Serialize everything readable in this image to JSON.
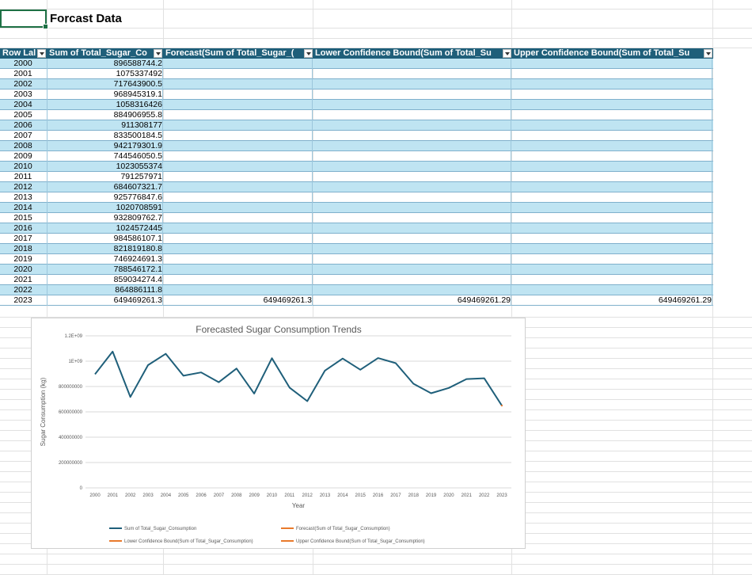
{
  "sheet": {
    "title": "Forcast Data"
  },
  "pivot": {
    "headers": [
      "Row Lal",
      "Sum of Total_Sugar_Co",
      "Forecast(Sum of Total_Sugar_(",
      "Lower Confidence Bound(Sum of Total_Su",
      "Upper Confidence Bound(Sum of Total_Su"
    ],
    "rows": [
      {
        "year": "2000",
        "sum": "896588744.2",
        "fc": "",
        "lo": "",
        "up": ""
      },
      {
        "year": "2001",
        "sum": "1075337492",
        "fc": "",
        "lo": "",
        "up": ""
      },
      {
        "year": "2002",
        "sum": "717643900.5",
        "fc": "",
        "lo": "",
        "up": ""
      },
      {
        "year": "2003",
        "sum": "968945319.1",
        "fc": "",
        "lo": "",
        "up": ""
      },
      {
        "year": "2004",
        "sum": "1058316426",
        "fc": "",
        "lo": "",
        "up": ""
      },
      {
        "year": "2005",
        "sum": "884906955.8",
        "fc": "",
        "lo": "",
        "up": ""
      },
      {
        "year": "2006",
        "sum": "911308177",
        "fc": "",
        "lo": "",
        "up": ""
      },
      {
        "year": "2007",
        "sum": "833500184.5",
        "fc": "",
        "lo": "",
        "up": ""
      },
      {
        "year": "2008",
        "sum": "942179301.9",
        "fc": "",
        "lo": "",
        "up": ""
      },
      {
        "year": "2009",
        "sum": "744546050.5",
        "fc": "",
        "lo": "",
        "up": ""
      },
      {
        "year": "2010",
        "sum": "1023055374",
        "fc": "",
        "lo": "",
        "up": ""
      },
      {
        "year": "2011",
        "sum": "791257971",
        "fc": "",
        "lo": "",
        "up": ""
      },
      {
        "year": "2012",
        "sum": "684607321.7",
        "fc": "",
        "lo": "",
        "up": ""
      },
      {
        "year": "2013",
        "sum": "925776847.6",
        "fc": "",
        "lo": "",
        "up": ""
      },
      {
        "year": "2014",
        "sum": "1020708591",
        "fc": "",
        "lo": "",
        "up": ""
      },
      {
        "year": "2015",
        "sum": "932809762.7",
        "fc": "",
        "lo": "",
        "up": ""
      },
      {
        "year": "2016",
        "sum": "1024572445",
        "fc": "",
        "lo": "",
        "up": ""
      },
      {
        "year": "2017",
        "sum": "984586107.1",
        "fc": "",
        "lo": "",
        "up": ""
      },
      {
        "year": "2018",
        "sum": "821819180.8",
        "fc": "",
        "lo": "",
        "up": ""
      },
      {
        "year": "2019",
        "sum": "746924691.3",
        "fc": "",
        "lo": "",
        "up": ""
      },
      {
        "year": "2020",
        "sum": "788546172.1",
        "fc": "",
        "lo": "",
        "up": ""
      },
      {
        "year": "2021",
        "sum": "859034274.4",
        "fc": "",
        "lo": "",
        "up": ""
      },
      {
        "year": "2022",
        "sum": "864886111.8",
        "fc": "",
        "lo": "",
        "up": ""
      },
      {
        "year": "2023",
        "sum": "649469261.3",
        "fc": "649469261.3",
        "lo": "649469261.29",
        "up": "649469261.29"
      }
    ]
  },
  "chart_data": {
    "type": "line",
    "title": "Forecasted Sugar Consumption Trends",
    "xlabel": "Year",
    "ylabel": "Sugar Consumption (kg)",
    "ylim": [
      0,
      1200000000
    ],
    "y_tick_labels": [
      "0",
      "200000000",
      "400000000",
      "600000000",
      "800000000",
      "1E+09",
      "1.2E+09"
    ],
    "categories": [
      "2000",
      "2001",
      "2002",
      "2003",
      "2004",
      "2005",
      "2006",
      "2007",
      "2008",
      "2009",
      "2010",
      "2011",
      "2012",
      "2013",
      "2014",
      "2015",
      "2016",
      "2017",
      "2018",
      "2019",
      "2020",
      "2021",
      "2022",
      "2023"
    ],
    "series": [
      {
        "name": "Sum of Total_Sugar_Consumption",
        "color": "#1f5f7a",
        "values": [
          896588744.2,
          1075337492,
          717643900.5,
          968945319.1,
          1058316426,
          884906955.8,
          911308177,
          833500184.5,
          942179301.9,
          744546050.5,
          1023055374,
          791257971,
          684607321.7,
          925776847.6,
          1020708591,
          932809762.7,
          1024572445,
          984586107.1,
          821819180.8,
          746924691.3,
          788546172.1,
          859034274.4,
          864886111.8,
          649469261.3
        ]
      },
      {
        "name": "Forecast(Sum of Total_Sugar_Consumption)",
        "color": "#e97a2c",
        "values": [
          null,
          null,
          null,
          null,
          null,
          null,
          null,
          null,
          null,
          null,
          null,
          null,
          null,
          null,
          null,
          null,
          null,
          null,
          null,
          null,
          null,
          null,
          null,
          649469261.3
        ]
      },
      {
        "name": "Lower Confidence Bound(Sum of Total_Sugar_Consumption)",
        "color": "#e97a2c",
        "values": [
          null,
          null,
          null,
          null,
          null,
          null,
          null,
          null,
          null,
          null,
          null,
          null,
          null,
          null,
          null,
          null,
          null,
          null,
          null,
          null,
          null,
          null,
          null,
          649469261.29
        ]
      },
      {
        "name": "Upper Confidence Bound(Sum of Total_Sugar_Consumption)",
        "color": "#e97a2c",
        "values": [
          null,
          null,
          null,
          null,
          null,
          null,
          null,
          null,
          null,
          null,
          null,
          null,
          null,
          null,
          null,
          null,
          null,
          null,
          null,
          null,
          null,
          null,
          null,
          649469261.29
        ]
      }
    ],
    "grid": true,
    "legend_position": "bottom"
  }
}
